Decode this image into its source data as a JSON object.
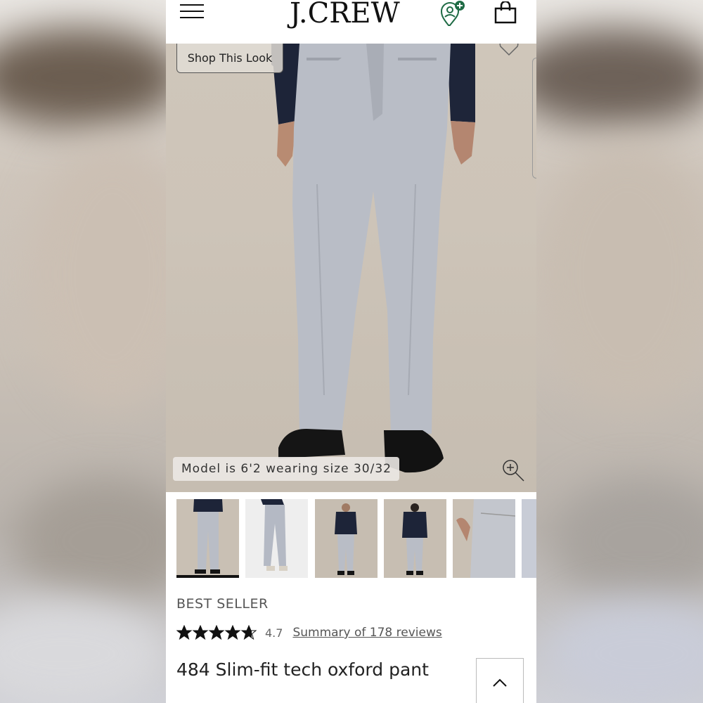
{
  "header": {
    "logo": "J.CREW",
    "menu_icon": "hamburger-menu-icon",
    "account_icon": "account-location-icon",
    "bag_icon": "shopping-bag-icon"
  },
  "hero": {
    "shop_look_label": "Shop This Look",
    "model_note": "Model is 6'2 wearing size 30/32",
    "favorite_icon": "heart-icon",
    "zoom_icon": "zoom-in-icon"
  },
  "thumbnails": [
    {
      "label": "front",
      "selected": true
    },
    {
      "label": "flat-lay",
      "selected": false
    },
    {
      "label": "full-look",
      "selected": false
    },
    {
      "label": "back",
      "selected": false
    },
    {
      "label": "pocket-detail",
      "selected": false
    },
    {
      "label": "fabric-detail",
      "selected": false
    }
  ],
  "product": {
    "badge": "BEST SELLER",
    "rating": "4.7",
    "stars": 4.7,
    "reviews_link": "Summary of 178 reviews",
    "name": "484 Slim-fit tech oxford pant"
  },
  "colors": {
    "accent_green": "#1f6b45",
    "text_dark": "#222222",
    "text_muted": "#555555"
  },
  "back_to_top_icon": "chevron-up-icon"
}
